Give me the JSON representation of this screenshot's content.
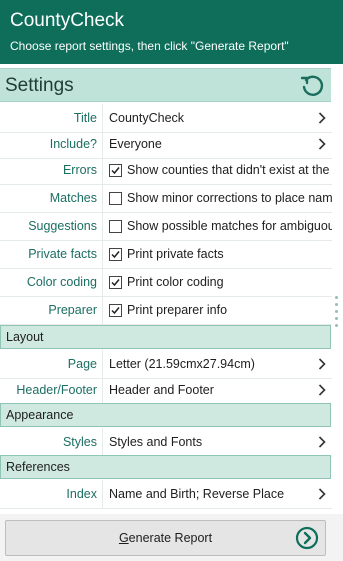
{
  "window": {
    "title": "CountyCheck",
    "subtitle": "Choose report settings, then click \"Generate Report\""
  },
  "settings": {
    "header": "Settings",
    "reset_icon": "refresh-icon"
  },
  "rows": {
    "title": {
      "label": "Title",
      "value": "CountyCheck"
    },
    "include": {
      "label": "Include?",
      "value": "Everyone"
    },
    "errors": {
      "label": "Errors",
      "text": "Show counties that didn't exist at the t",
      "checked": true
    },
    "matches": {
      "label": "Matches",
      "text": "Show minor corrections to place name",
      "checked": false
    },
    "suggestions": {
      "label": "Suggestions",
      "text": "Show possible matches for ambiguous",
      "checked": false
    },
    "private_facts": {
      "label": "Private facts",
      "text": "Print private facts",
      "checked": true
    },
    "color_coding": {
      "label": "Color coding",
      "text": "Print color coding",
      "checked": true
    },
    "preparer": {
      "label": "Preparer",
      "text": "Print preparer info",
      "checked": true
    },
    "page": {
      "label": "Page",
      "value": "Letter (21.59cmx27.94cm)"
    },
    "header_footer": {
      "label": "Header/Footer",
      "value": "Header and Footer"
    },
    "styles": {
      "label": "Styles",
      "value": "Styles and Fonts"
    },
    "index": {
      "label": "Index",
      "value": "Name and Birth; Reverse Place"
    }
  },
  "sections": {
    "layout": "Layout",
    "appearance": "Appearance",
    "references": "References"
  },
  "footer": {
    "generate_first": "G",
    "generate_rest": "enerate Report"
  },
  "colors": {
    "accent": "#0e6e5a",
    "section_bg": "#cfe9e1",
    "label": "#1b6e62"
  }
}
